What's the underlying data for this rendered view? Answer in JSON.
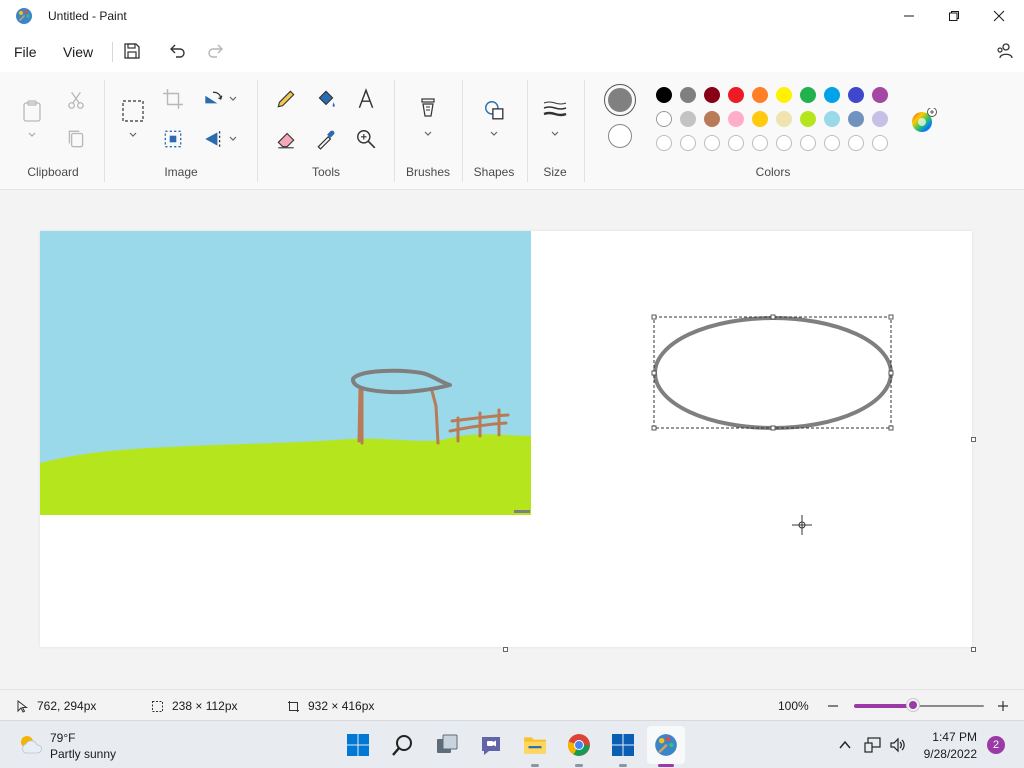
{
  "window": {
    "title": "Untitled - Paint"
  },
  "menu": {
    "file": "File",
    "view": "View"
  },
  "ribbon": {
    "groups": {
      "clipboard": "Clipboard",
      "image": "Image",
      "tools": "Tools",
      "brushes": "Brushes",
      "shapes": "Shapes",
      "size": "Size",
      "colors": "Colors"
    },
    "primary_color": "#808080",
    "secondary_color": "#ffffff",
    "palette_row1": [
      "#000000",
      "#7f7f7f",
      "#880015",
      "#ed1c24",
      "#ff7f27",
      "#fff200",
      "#22b14c",
      "#00a2e8",
      "#3f48cc",
      "#a349a4"
    ],
    "palette_row2": [
      "#ffffff",
      "#c3c3c3",
      "#b97a57",
      "#ffaec9",
      "#ffc90e",
      "#efe4b0",
      "#b5e61d",
      "#99d9ea",
      "#7092be",
      "#c8bfe7"
    ],
    "palette_row3_empty_count": 10
  },
  "drawing": {
    "sky_color": "#99d9ea",
    "grass_color": "#b5e61d",
    "pavilion_roof_color": "#7f7f7f",
    "pavilion_legs_color": "#b97a57",
    "ellipse_color": "#7f7f7f"
  },
  "status": {
    "cursor_pos": "762, 294px",
    "selection_size": "238 × 112px",
    "canvas_size": "932 × 416px",
    "zoom": "100%",
    "zoom_level": 0.45
  },
  "taskbar": {
    "weather_temp": "79°F",
    "weather_desc": "Partly sunny",
    "time": "1:47 PM",
    "date": "9/28/2022",
    "notifications": "2"
  }
}
